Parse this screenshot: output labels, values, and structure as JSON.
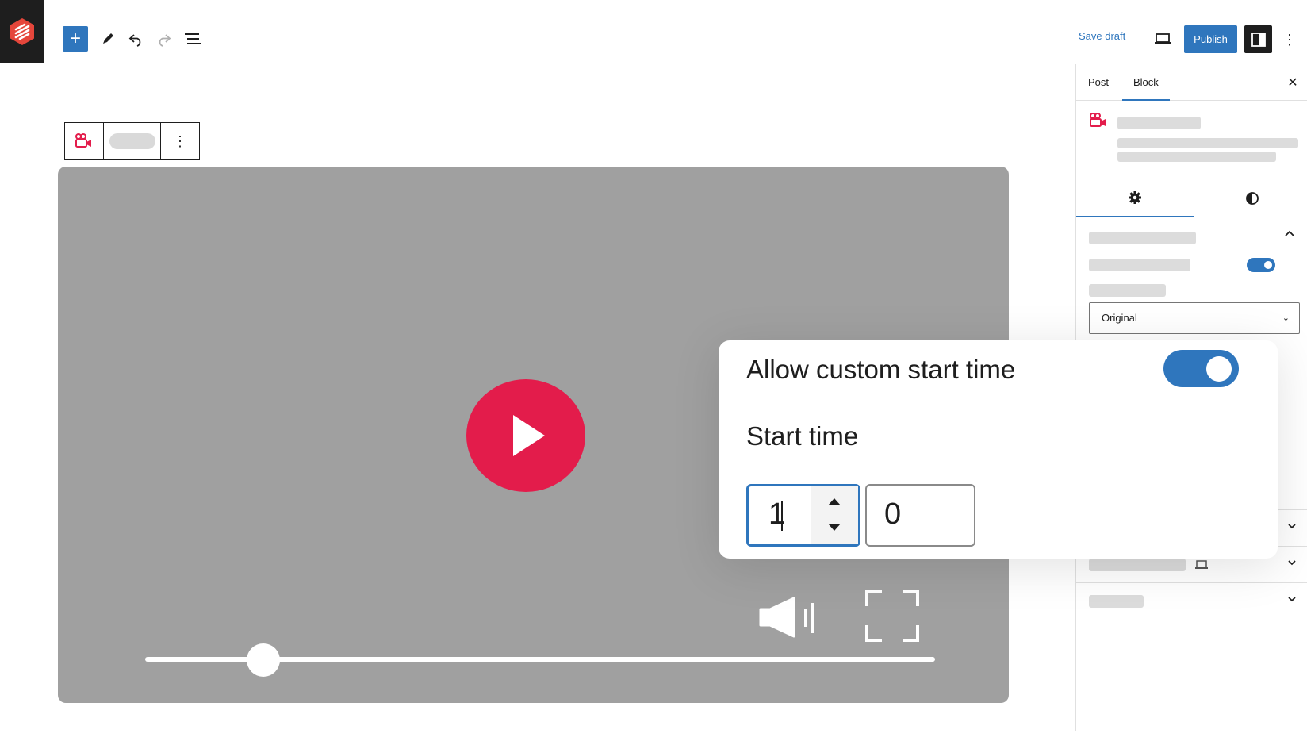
{
  "topbar": {
    "save_draft_label": "Save draft",
    "publish_label": "Publish",
    "more_glyph": "⋮",
    "add_glyph": "+",
    "icons": [
      "site-logo-icon",
      "pen-tool-icon",
      "undo-icon",
      "redo-icon",
      "list-view-icon",
      "desktop-preview-icon",
      "sidebar-settings-icon",
      "more-options-icon"
    ]
  },
  "block_toolbar": {
    "more_glyph": "⋮",
    "icons": [
      "video-camera-icon",
      "more-options-icon"
    ]
  },
  "video": {
    "progress_fraction": 0.15,
    "icons": [
      "play-icon",
      "volume-icon",
      "fullscreen-icon"
    ]
  },
  "sidebar": {
    "tabs": [
      {
        "label": "Post",
        "active": false
      },
      {
        "label": "Block",
        "active": true
      }
    ],
    "close_glyph": "✕",
    "subtabs": [
      "settings-gear-icon",
      "styles-contrast-icon"
    ],
    "select_value": "Original",
    "select_chevron": "⌄",
    "toggle_on": true
  },
  "popup": {
    "allow_custom_start_label": "Allow custom start time",
    "allow_custom_start_on": true,
    "start_time_label": "Start time",
    "hours_value": "1",
    "minutes_value": "0"
  },
  "colors": {
    "accent": "#2f76bd",
    "play_red": "#e31c4b",
    "video_gray": "#a0a0a0",
    "dark": "#1e1e1e"
  }
}
